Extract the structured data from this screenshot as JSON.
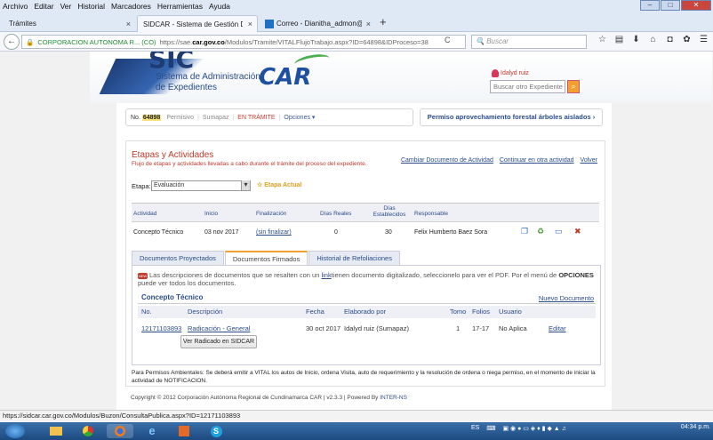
{
  "menu": [
    "Archivo",
    "Editar",
    "Ver",
    "Historial",
    "Marcadores",
    "Herramientas",
    "Ayuda"
  ],
  "tabs": [
    {
      "label": "Trámites"
    },
    {
      "label": "SIDCAR - Sistema de Gestión Do"
    },
    {
      "label": "Correo - Dianitha_admon@"
    }
  ],
  "url": {
    "site": "CORPORACION AUTONOMA R... (CO)",
    "prefix": "https://sae.",
    "host": "car.gov.co",
    "path": "/Modulos/Tramite/VITALFlujoTrabajo.aspx?ID=64898&IDProceso=38"
  },
  "search": {
    "placeholder": "Buscar"
  },
  "header": {
    "sic": "SIC",
    "line1": "Sistema de Administración",
    "line2": "de Expedientes",
    "car": "CAR",
    "user": "Idalyd ruiz",
    "other_expediente_placeholder": "Buscar otro Expediente"
  },
  "process": {
    "no_label": "No.",
    "number": "64898",
    "type": "Permisivo",
    "region": "Sumapaz",
    "status": "EN TRÁMITE",
    "options": "Opciones ▾",
    "title": "Permiso aprovechamiento forestal árboles aislados ›"
  },
  "panel": {
    "title": "Etapas y Actividades",
    "subtitle": "Flujo de etapas y actividades llevadas a cabo durante el trámite del proceso del expediente.",
    "links": [
      "Cambiar Documento de Actividad",
      "Continuar en otra actividad",
      "Volver"
    ],
    "etapa_label": "Etapa:",
    "etapa_value": "Evaluación",
    "etapa_actual": "☆ Etapa Actual"
  },
  "activity": {
    "headers": [
      "Actividad",
      "Inicio",
      "Finalización",
      "Días Reales",
      "Días Establecidos",
      "Responsable"
    ],
    "row": {
      "actividad": "Concepto Técnico",
      "inicio": "03 nov 2017",
      "finalizacion": "(sin finalizar)",
      "dias_reales": "0",
      "dias_establecidos": "30",
      "responsable": "Felix Humberto Baez Sora"
    }
  },
  "doc_tabs": [
    "Documentos Proyectados",
    "Documentos Firmados",
    "Historial de Refoliaciones"
  ],
  "note": {
    "badge": "NEW",
    "text1": "Las descripciones de documentos que se resalten con un ",
    "link": "link",
    "text2": "tienen documento digitalizado, seleccionelo para ver el PDF. Por el menú de ",
    "bold": "OPCIONES",
    "text3": " puede ver todos los documentos."
  },
  "section": {
    "title": "Concepto Técnico",
    "new_doc": "Nuevo Documento"
  },
  "doc_table": {
    "headers": [
      "No.",
      "Descripción",
      "Fecha",
      "Elaborado por",
      "Tomo",
      "Folios",
      "Usuario"
    ],
    "row": {
      "no": "12171103893",
      "descripcion": "Radicación - General",
      "fecha": "30 oct 2017",
      "elaborado": "Idalyd ruiz (Sumapaz)",
      "tomo": "1",
      "folios": "17-17",
      "usuario": "No Aplica",
      "action": "Editar"
    },
    "button": "Ver Radicado en SIDCAR"
  },
  "footnote": "Para Permisos Ambientales: Se deberá emitir a VITAL los autos de Inicio, ordena Visita, auto de requerimiento y la resolución de ordena o niega permiso, en el momento de iniciar la actividad de NOTIFICACION.",
  "copyright": {
    "text": "Copyright © 2012 Corporación Autónoma Regional de Cundinamarca CAR | v2.3.3 | Powered By ",
    "link": "INTER-NS"
  },
  "status_url": "https://sidcar.car.gov.co/Modulos/Buzon/ConsultaPublica.aspx?ID=12171103893",
  "taskbar": {
    "lang": "ES",
    "time": "04:34 p.m."
  }
}
